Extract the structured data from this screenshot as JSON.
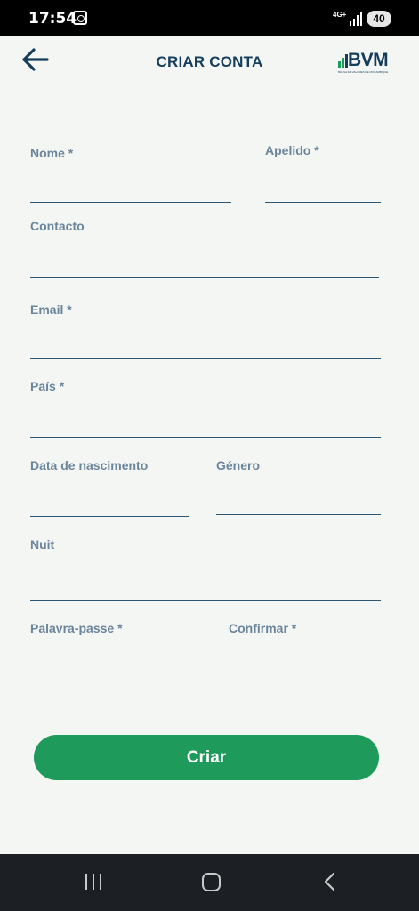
{
  "status_bar": {
    "time": "17:54",
    "network": "4G+",
    "battery": "40"
  },
  "header": {
    "title": "CRIAR CONTA",
    "logo_text": "BVM",
    "logo_subtext": "BOLSA DE VALORES DE MOÇAMBIQUE"
  },
  "form": {
    "nome": {
      "label": "Nome *",
      "value": ""
    },
    "apelido": {
      "label": "Apelido *",
      "value": ""
    },
    "contacto": {
      "label": "Contacto",
      "value": ""
    },
    "email": {
      "label": "Email *",
      "value": ""
    },
    "pais": {
      "label": "País *",
      "value": ""
    },
    "data_nascimento": {
      "label": "Data de nascimento",
      "value": ""
    },
    "genero": {
      "label": "Género",
      "value": ""
    },
    "nuit": {
      "label": "Nuit",
      "value": ""
    },
    "palavra_passe": {
      "label": "Palavra-passe *",
      "value": ""
    },
    "confirmar": {
      "label": "Confirmar *",
      "value": ""
    },
    "submit_label": "Criar"
  },
  "colors": {
    "accent": "#1e9a5a",
    "title": "#153d5c",
    "label": "#6b859c",
    "background": "#f3f6f3"
  }
}
